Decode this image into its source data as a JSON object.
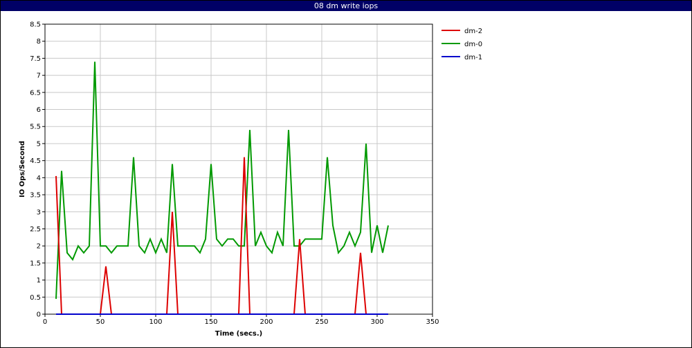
{
  "window": {
    "title": "08 dm write iops"
  },
  "chart_data": {
    "type": "line",
    "title": "08 dm write iops",
    "xlabel": "Time (secs.)",
    "ylabel": "IO Ops/Second",
    "xlim": [
      0,
      350
    ],
    "ylim": [
      0,
      8.5
    ],
    "x_ticks": [
      0,
      50,
      100,
      150,
      200,
      250,
      300,
      350
    ],
    "y_ticks": [
      0,
      0.5,
      1,
      1.5,
      2,
      2.5,
      3,
      3.5,
      4,
      4.5,
      5,
      5.5,
      6,
      6.5,
      7,
      7.5,
      8,
      8.5
    ],
    "grid": true,
    "legend_position": "right-top",
    "series": [
      {
        "name": "dm-2",
        "color": "#dd0000",
        "points": [
          [
            10,
            4.05
          ],
          [
            15,
            0
          ],
          [
            20,
            0
          ],
          [
            25,
            0
          ],
          [
            30,
            0
          ],
          [
            35,
            0
          ],
          [
            40,
            0
          ],
          [
            45,
            0
          ],
          [
            50,
            0
          ],
          [
            55,
            1.4
          ],
          [
            60,
            0
          ],
          [
            65,
            0
          ],
          [
            70,
            0
          ],
          [
            75,
            0
          ],
          [
            80,
            0
          ],
          [
            85,
            0
          ],
          [
            90,
            0
          ],
          [
            95,
            0
          ],
          [
            100,
            0
          ],
          [
            105,
            0
          ],
          [
            110,
            0
          ],
          [
            115,
            3.0
          ],
          [
            120,
            0
          ],
          [
            125,
            0
          ],
          [
            130,
            0
          ],
          [
            135,
            0
          ],
          [
            140,
            0
          ],
          [
            145,
            0
          ],
          [
            150,
            0
          ],
          [
            155,
            0
          ],
          [
            160,
            0
          ],
          [
            165,
            0
          ],
          [
            170,
            0
          ],
          [
            175,
            0
          ],
          [
            180,
            4.6
          ],
          [
            185,
            0
          ],
          [
            190,
            0
          ],
          [
            195,
            0
          ],
          [
            200,
            0
          ],
          [
            205,
            0
          ],
          [
            210,
            0
          ],
          [
            215,
            0
          ],
          [
            220,
            0
          ],
          [
            225,
            0
          ],
          [
            230,
            2.2
          ],
          [
            235,
            0
          ],
          [
            240,
            0
          ],
          [
            245,
            0
          ],
          [
            250,
            0
          ],
          [
            255,
            0
          ],
          [
            260,
            0
          ],
          [
            265,
            0
          ],
          [
            270,
            0
          ],
          [
            275,
            0
          ],
          [
            280,
            0
          ],
          [
            285,
            1.8
          ],
          [
            290,
            0
          ],
          [
            295,
            0
          ],
          [
            300,
            0
          ],
          [
            305,
            0
          ],
          [
            310,
            0
          ]
        ]
      },
      {
        "name": "dm-0",
        "color": "#009900",
        "points": [
          [
            10,
            0.45
          ],
          [
            15,
            4.2
          ],
          [
            20,
            1.8
          ],
          [
            25,
            1.6
          ],
          [
            30,
            2.0
          ],
          [
            35,
            1.8
          ],
          [
            40,
            2.0
          ],
          [
            45,
            7.4
          ],
          [
            50,
            2.0
          ],
          [
            55,
            2.0
          ],
          [
            60,
            1.8
          ],
          [
            65,
            2.0
          ],
          [
            70,
            2.0
          ],
          [
            75,
            2.0
          ],
          [
            80,
            4.6
          ],
          [
            85,
            2.0
          ],
          [
            90,
            1.8
          ],
          [
            95,
            2.2
          ],
          [
            100,
            1.8
          ],
          [
            105,
            2.2
          ],
          [
            110,
            1.8
          ],
          [
            115,
            4.4
          ],
          [
            120,
            2.0
          ],
          [
            125,
            2.0
          ],
          [
            130,
            2.0
          ],
          [
            135,
            2.0
          ],
          [
            140,
            1.8
          ],
          [
            145,
            2.2
          ],
          [
            150,
            4.4
          ],
          [
            155,
            2.2
          ],
          [
            160,
            2.0
          ],
          [
            165,
            2.2
          ],
          [
            170,
            2.2
          ],
          [
            175,
            2.0
          ],
          [
            180,
            2.0
          ],
          [
            185,
            5.4
          ],
          [
            190,
            2.0
          ],
          [
            195,
            2.4
          ],
          [
            200,
            2.0
          ],
          [
            205,
            1.8
          ],
          [
            210,
            2.4
          ],
          [
            215,
            2.0
          ],
          [
            220,
            5.4
          ],
          [
            225,
            2.0
          ],
          [
            230,
            2.0
          ],
          [
            235,
            2.2
          ],
          [
            240,
            2.2
          ],
          [
            245,
            2.2
          ],
          [
            250,
            2.2
          ],
          [
            255,
            4.6
          ],
          [
            260,
            2.6
          ],
          [
            265,
            1.8
          ],
          [
            270,
            2.0
          ],
          [
            275,
            2.4
          ],
          [
            280,
            2.0
          ],
          [
            285,
            2.4
          ],
          [
            290,
            5.0
          ],
          [
            295,
            1.8
          ],
          [
            300,
            2.6
          ],
          [
            305,
            1.8
          ],
          [
            310,
            2.6
          ]
        ]
      },
      {
        "name": "dm-1",
        "color": "#0000cc",
        "points": [
          [
            10,
            0
          ],
          [
            15,
            0
          ],
          [
            20,
            0
          ],
          [
            60,
            0
          ],
          [
            110,
            0
          ],
          [
            180,
            0
          ],
          [
            230,
            0
          ],
          [
            290,
            0
          ],
          [
            310,
            0
          ]
        ]
      }
    ]
  }
}
